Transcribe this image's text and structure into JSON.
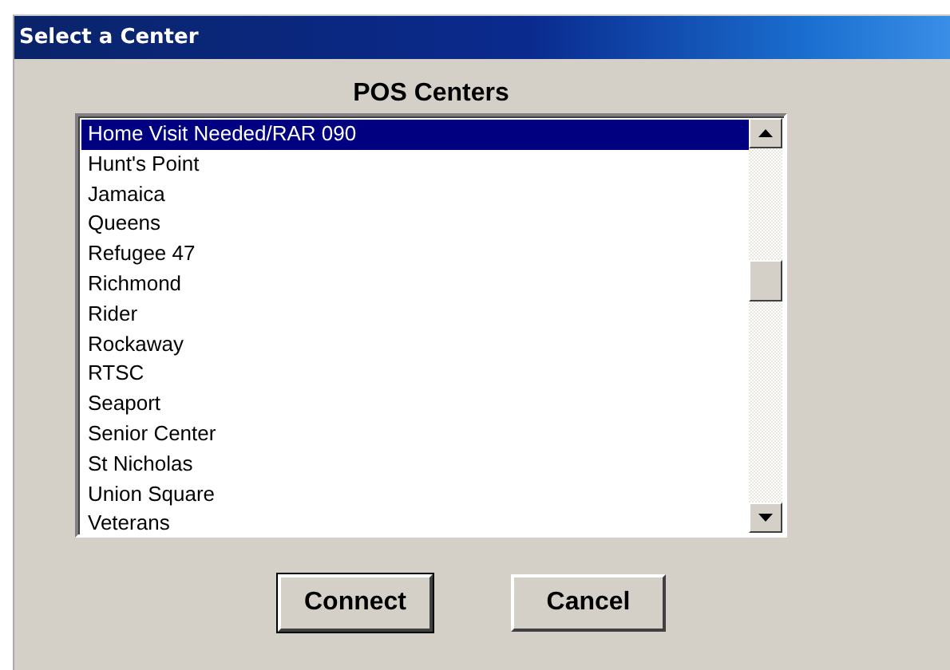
{
  "window": {
    "title": "Select a Center"
  },
  "list": {
    "label": "POS Centers",
    "items": [
      {
        "text": "Home Visit Needed/RAR 090",
        "selected": true
      },
      {
        "text": "Hunt's Point",
        "selected": false
      },
      {
        "text": "Jamaica",
        "selected": false
      },
      {
        "text": "Queens",
        "selected": false
      },
      {
        "text": "Refugee 47",
        "selected": false
      },
      {
        "text": "Richmond",
        "selected": false
      },
      {
        "text": "Rider",
        "selected": false
      },
      {
        "text": "Rockaway",
        "selected": false
      },
      {
        "text": "RTSC",
        "selected": false
      },
      {
        "text": "Seaport",
        "selected": false
      },
      {
        "text": "Senior Center",
        "selected": false
      },
      {
        "text": "St Nicholas",
        "selected": false
      },
      {
        "text": "Union Square",
        "selected": false
      },
      {
        "text": "Veterans",
        "selected": false
      }
    ]
  },
  "buttons": [
    {
      "label": "Connect",
      "default": true
    },
    {
      "label": "Cancel",
      "default": false
    }
  ]
}
